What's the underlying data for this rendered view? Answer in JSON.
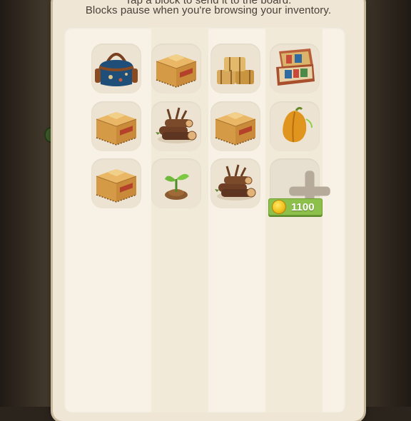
{
  "header": {
    "line1": "Tap a block to send it to the board.",
    "line2": "Blocks pause when you're browsing your inventory."
  },
  "inventory": {
    "slots": [
      {
        "item": "travel-bag-icon"
      },
      {
        "item": "cardboard-box-icon"
      },
      {
        "item": "hay-bales-icon"
      },
      {
        "item": "open-suitcase-icon"
      },
      {
        "item": "cardboard-box-icon"
      },
      {
        "item": "log-pile-icon"
      },
      {
        "item": "cardboard-box-icon"
      },
      {
        "item": "squash-seed-icon"
      },
      {
        "item": "cardboard-box-icon"
      },
      {
        "item": "sprout-icon"
      },
      {
        "item": "log-pile-icon"
      }
    ],
    "add_slot": {
      "icon": "plus-icon",
      "price": "1100",
      "currency_icon": "coin-icon"
    }
  },
  "colors": {
    "panel": "#efe6d6",
    "inner_panel": "#f7f1e6",
    "slot": "#ece3d2",
    "price_tag": "#8dc04a",
    "text": "#4b4038"
  }
}
